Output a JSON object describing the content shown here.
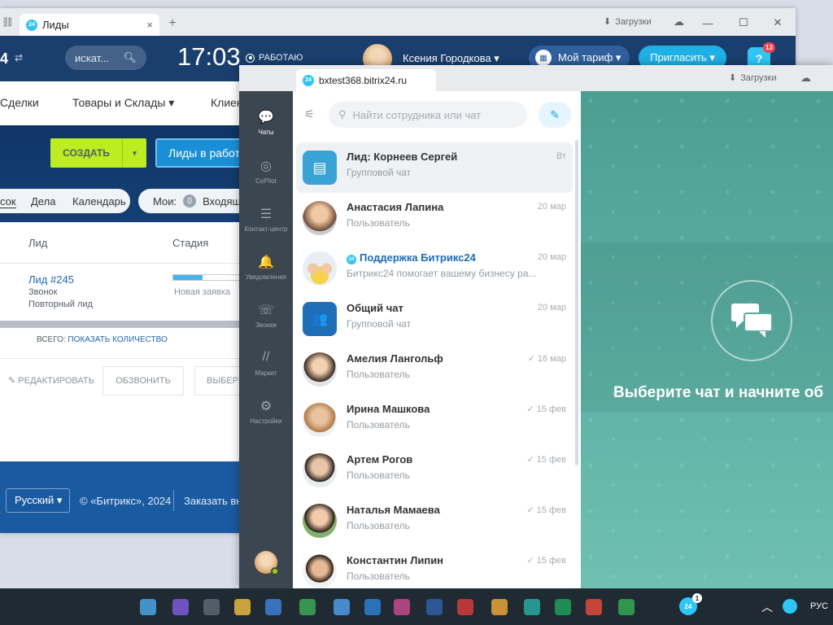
{
  "back_window": {
    "tab_label": "Лиды",
    "tab_close": "×",
    "new_tab": "+",
    "downloads": "Загрузки",
    "window_controls": [
      "—",
      "☐",
      "✕"
    ],
    "header": {
      "logo_fragment": "4",
      "search_placeholder": "искат...",
      "time": "17:03",
      "status": "РАБОТАЮ",
      "user_name": "Ксения Городкова ▾",
      "tariff_label": "Мой тариф ▾",
      "invite_label": "Пригласить ▾",
      "help_label": "?",
      "notification_count": "13"
    },
    "nav": [
      "Сделки",
      "Товары и Склады ▾",
      "Клиен"
    ],
    "create_button": "СОЗДАТЬ",
    "create_arrow": "▾",
    "filter_label": "Лиды в работе",
    "subnav": [
      "сок",
      "Дела",
      "Календарь"
    ],
    "my_label": "Мои:",
    "my_count": "0",
    "my_incoming": "Входящ",
    "table": {
      "col_lead": "Лид",
      "col_stage": "Стадия",
      "row": {
        "title": "Лид #245",
        "source": "Звонок",
        "repeat": "Повторный лид",
        "stage": "Новая заявка",
        "stage_progress": 0.42
      }
    },
    "total_label": "ВСЕГО:",
    "total_link": "ПОКАЗАТЬ КОЛИЧЕСТВО",
    "edit_label": "РЕДАКТИРОВАТЬ",
    "call_label": "ОБЗВОНИТЬ",
    "select_label": "ВЫБЕРИ",
    "footer": {
      "language": "Русский ▾",
      "copyright": "© «Битрикс», 2024",
      "order": "Заказать вне"
    }
  },
  "front_window": {
    "tab_label": "bxtest368.bitrix24.ru",
    "downloads": "Загрузки",
    "sidebar": [
      {
        "icon": "chat-icon",
        "glyph": "💬",
        "label": "Чаты"
      },
      {
        "icon": "copilot-icon",
        "glyph": "◎",
        "label": "CoPilot"
      },
      {
        "icon": "contact-center-icon",
        "glyph": "☰",
        "label": "Контакт-центр"
      },
      {
        "icon": "bell-icon",
        "glyph": "🔔",
        "label": "Уведомления"
      },
      {
        "icon": "phone-icon",
        "glyph": "☏",
        "label": "Звонки"
      },
      {
        "icon": "market-icon",
        "glyph": "//",
        "label": "Маркет"
      },
      {
        "icon": "gear-icon",
        "glyph": "⚙",
        "label": "Настройки"
      }
    ],
    "search_placeholder": "Найти сотрудника или чат",
    "chats": [
      {
        "name": "Лид: Корнеев Сергей",
        "subtitle": "Групповой чат",
        "date": "Вт",
        "read": false
      },
      {
        "name": "Анастасия Лапина",
        "subtitle": "Пользователь",
        "date": "20 мар",
        "read": false
      },
      {
        "name": "Поддержка Битрикс24",
        "subtitle": "Битрикс24 помогает вашему бизнесу ра...",
        "date": "20 мар",
        "read": false
      },
      {
        "name": "Общий чат",
        "subtitle": "Групповой чат",
        "date": "20 мар",
        "read": false
      },
      {
        "name": "Амелия Лангольф",
        "subtitle": "Пользователь",
        "date": "16 мар",
        "read": true
      },
      {
        "name": "Ирина Машкова",
        "subtitle": "Пользователь",
        "date": "15 фев",
        "read": true
      },
      {
        "name": "Артем Рогов",
        "subtitle": "Пользователь",
        "date": "15 фев",
        "read": true
      },
      {
        "name": "Наталья Мамаева",
        "subtitle": "Пользователь",
        "date": "15 фев",
        "read": true
      },
      {
        "name": "Константин Липин",
        "subtitle": "Пользователь",
        "date": "15 фев",
        "read": true
      }
    ],
    "empty_state": "Выберите чат и начните об"
  },
  "taskbar": {
    "bitrix_badge": "1",
    "language": "РУС"
  }
}
